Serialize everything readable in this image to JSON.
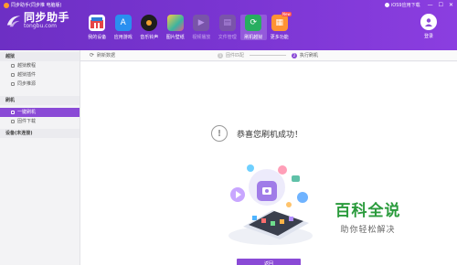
{
  "titlebar": {
    "title": "同步助手(同步推 电脑版)",
    "ios_link": "iOS9应用下载",
    "win_buttons": [
      "—",
      "☐",
      "✕"
    ]
  },
  "logo": {
    "name": "同步助手",
    "domain": "tongbu.com"
  },
  "nav": [
    {
      "label": "我的设备",
      "icon": "my-device-icon",
      "color": "#e64545"
    },
    {
      "label": "应用游戏",
      "icon": "app-store-icon",
      "color": "#2a8ff0"
    },
    {
      "label": "音乐铃声",
      "icon": "music-icon",
      "color": "#1e1e1e"
    },
    {
      "label": "图片壁纸",
      "icon": "wallpaper-icon",
      "color": "#3bb3a0"
    },
    {
      "label": "视频播放",
      "icon": "video-icon",
      "color": "#7b7b7b"
    },
    {
      "label": "文件管理",
      "icon": "file-icon",
      "color": "#7b7b7b"
    },
    {
      "label": "刷机越狱",
      "icon": "flash-icon",
      "color": "#27ae60"
    },
    {
      "label": "更多功能",
      "icon": "more-icon",
      "color": "#ff9333",
      "badge": "New"
    }
  ],
  "login": {
    "label": "登录"
  },
  "sidebar": {
    "groups": [
      {
        "title": "越狱",
        "items": [
          "越狱教程",
          "越狱插件",
          "同步推源"
        ]
      },
      {
        "title": "刷机",
        "items": [
          "一键刷机",
          "固件下载"
        ]
      },
      {
        "title": "设备(未连接)",
        "items": []
      }
    ],
    "active": "一键刷机"
  },
  "crumb": {
    "refresh": "刷新数据",
    "steps": [
      {
        "num": "1",
        "label": "固件匹配"
      },
      {
        "num": "2",
        "label": "执行刷机"
      }
    ]
  },
  "main": {
    "success_message": "恭喜您刷机成功！",
    "return_button": "返回"
  },
  "watermark": {
    "line1": "百科全说",
    "line2": "助你轻松解决"
  }
}
